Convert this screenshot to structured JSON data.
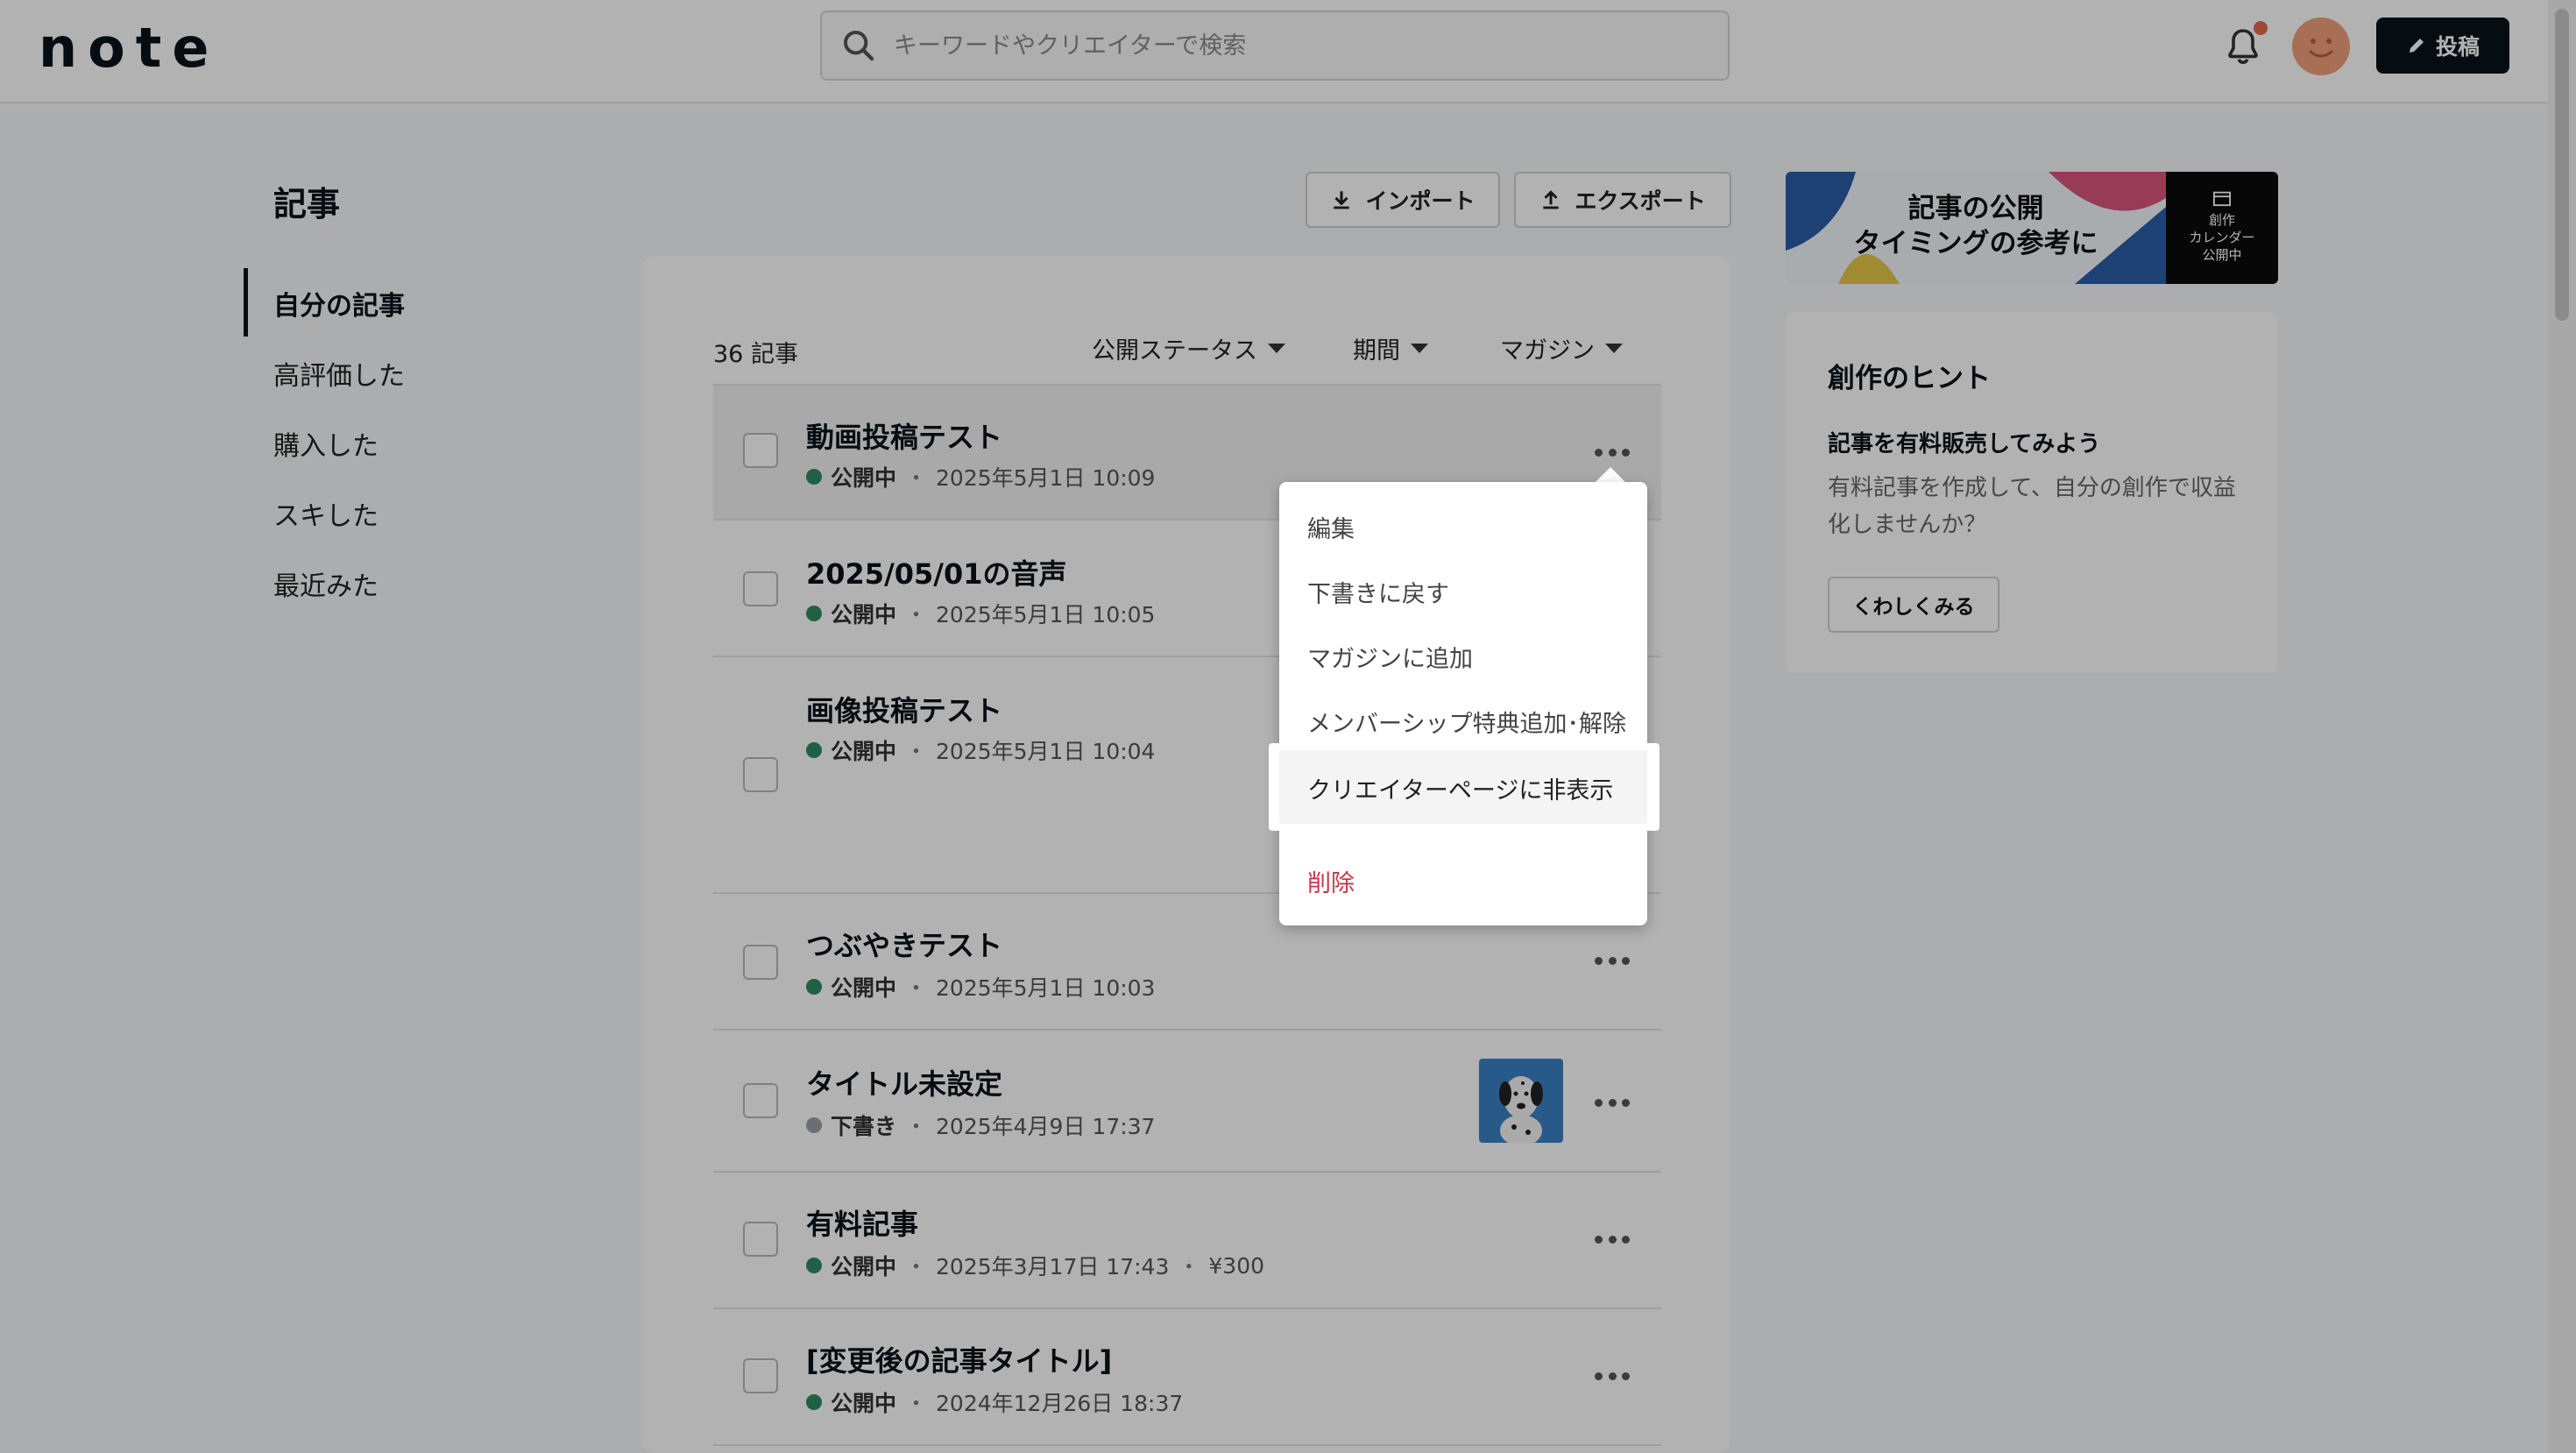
{
  "header": {
    "logo": "note",
    "search_placeholder": "キーワードやクリエイターで検索",
    "post_label": "投稿"
  },
  "nav": {
    "title": "記事",
    "items": [
      {
        "label": "自分の記事",
        "active": true
      },
      {
        "label": "高評価した"
      },
      {
        "label": "購入した"
      },
      {
        "label": "スキした"
      },
      {
        "label": "最近みた"
      }
    ]
  },
  "toolbar": {
    "import_label": "インポート",
    "export_label": "エクスポート"
  },
  "list": {
    "count": "36 記事",
    "filters": {
      "status": "公開ステータス",
      "period": "期間",
      "magazine": "マガジン"
    },
    "rows": [
      {
        "title": "動画投稿テスト",
        "status": "公開中",
        "date": "2025年5月1日 10:09"
      },
      {
        "title": "2025/05/01の音声",
        "status": "公開中",
        "date": "2025年5月1日 10:05"
      },
      {
        "title": "画像投稿テスト",
        "status": "公開中",
        "date": "2025年5月1日 10:04"
      },
      {
        "title": "つぶやきテスト",
        "status": "公開中",
        "date": "2025年5月1日 10:03"
      },
      {
        "title": "タイトル未設定",
        "status": "下書き",
        "date": "2025年4月9日 17:37"
      },
      {
        "title": "有料記事",
        "status": "公開中",
        "date": "2025年3月17日 17:43",
        "price": "¥300"
      },
      {
        "title": "[変更後の記事タイトル]",
        "status": "公開中",
        "date": "2024年12月26日 18:37"
      }
    ],
    "separator": "・"
  },
  "dropdown": {
    "items": [
      "編集",
      "下書きに戻す",
      "マガジンに追加",
      "メンバーシップ特典追加･解除",
      "クリエイターページに非表示"
    ],
    "delete_label": "削除",
    "highlighted_index": 4
  },
  "banner": {
    "line1": "記事の公開",
    "line2": "タイミングの参考に",
    "side_line1": "創作",
    "side_line2": "カレンダー",
    "side_line3": "公開中"
  },
  "hint": {
    "title": "創作のヒント",
    "subtitle": "記事を有料販売してみよう",
    "body": "有料記事を作成して、自分の創作で収益化しませんか？",
    "button": "くわしくみる"
  },
  "colors": {
    "published": "#2e8b62",
    "draft": "#9aa0a6",
    "danger": "#c7354a",
    "notification_dot": "#e36b4b",
    "avatar": "#f0a07c"
  }
}
